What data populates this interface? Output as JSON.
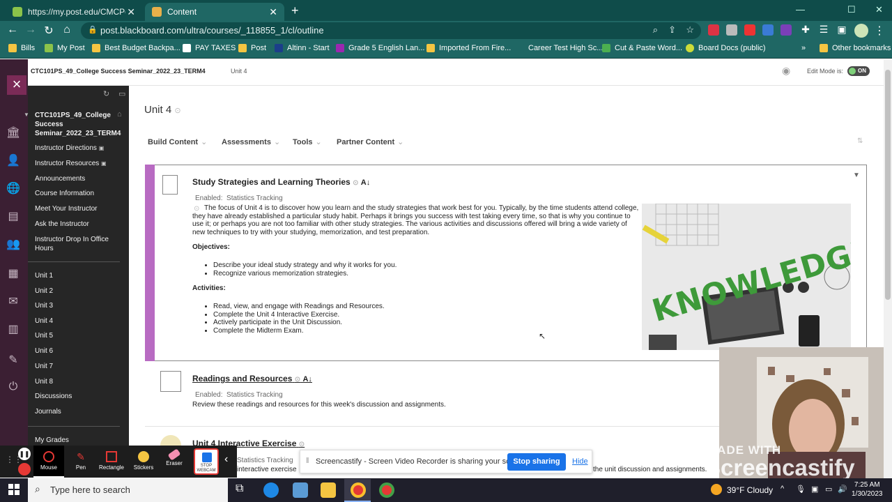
{
  "browser": {
    "tabs": [
      {
        "label": "https://my.post.edu/CMCPortal/"
      },
      {
        "label": "Content"
      }
    ],
    "url": "post.blackboard.com/ultra/courses/_118855_1/cl/outline",
    "bookmarks": [
      "Bills",
      "My Post",
      "Best Budget Backpa...",
      "PAY TAXES",
      "Post",
      "Altinn - Start",
      "Grade 5 English Lan...",
      "Imported From Fire...",
      "Career Test High Sc...",
      "Cut & Paste Word...",
      "Board Docs (public)",
      "Other bookmarks"
    ],
    "more_bookmarks": "»"
  },
  "header": {
    "course": "CTC101PS_49_College Success Seminar_2022_23_TERM4",
    "crumb": "Unit 4",
    "edit_mode_label": "Edit Mode is:",
    "edit_mode_value": "ON"
  },
  "sidebar": {
    "course_title": "CTC101PS_49_College Success Seminar_2022_23_TERM4",
    "items": [
      "Instructor Directions",
      "Instructor Resources",
      "Announcements",
      "Course Information",
      "Meet Your Instructor",
      "Ask the Instructor",
      "Instructor Drop In Office Hours"
    ],
    "units": [
      "Unit 1",
      "Unit 2",
      "Unit 3",
      "Unit 4",
      "Unit 5",
      "Unit 6",
      "Unit 7",
      "Unit 8",
      "Discussions",
      "Journals"
    ],
    "grades": "My Grades"
  },
  "main": {
    "page_title": "Unit 4",
    "menus": [
      "Build Content",
      "Assessments",
      "Tools",
      "Partner Content"
    ],
    "item1": {
      "title": "Study Strategies and Learning Theories",
      "enabled": "Enabled:",
      "tracking": "Statistics Tracking",
      "intro": "The focus of Unit 4 is to discover how you learn and the study strategies that work best for you. Typically, by the time students attend college, they have already established a particular study habit. Perhaps it brings you success with test taking every time, so that is why you continue to use it; or perhaps you are not too familiar with other study strategies. The various activities and discussions offered will bring a wide variety of new techniques to try with your studying, memorization, and test preparation.",
      "objectives_label": "Objectives:",
      "objectives": [
        "Describe your ideal study strategy and why it works for you.",
        "Recognize various memorization strategies."
      ],
      "activities_label": "Activities:",
      "activities": [
        "Read, view, and engage with Readings and Resources.",
        "Complete the Unit 4 Interactive Exercise.",
        "Actively participate in the Unit Discussion.",
        "Complete the Midterm Exam."
      ],
      "image_text": "KNOWLEDGE"
    },
    "item2": {
      "title": "Readings and Resources",
      "enabled": "Enabled:",
      "tracking": "Statistics Tracking",
      "desc": "Review these readings and resources for this week's discussion and assignments."
    },
    "item3": {
      "title": "Unit 4 Interactive Exercise",
      "tracking": "Statistics Tracking",
      "desc_left": "interactive exercise",
      "desc_right": "the unit discussion and assignments."
    }
  },
  "screencastify": {
    "tools": [
      "Mouse",
      "Pen",
      "Rectangle",
      "Stickers",
      "Eraser",
      "STOP WEBCAM"
    ],
    "share_text": "Screencastify - Screen Video Recorder is sharing your screen.",
    "stop_label": "Stop sharing",
    "hide_label": "Hide",
    "watermark_small": "MADE WITH",
    "watermark_big": "Screencastify"
  },
  "taskbar": {
    "search_placeholder": "Type here to search",
    "weather": "39°F Cloudy",
    "time": "7:25 AM",
    "date": "1/30/2023"
  },
  "colors": {
    "accent_teal": "#1f6764",
    "purple_bar": "#b86bc2",
    "blue_button": "#1a73e8"
  }
}
